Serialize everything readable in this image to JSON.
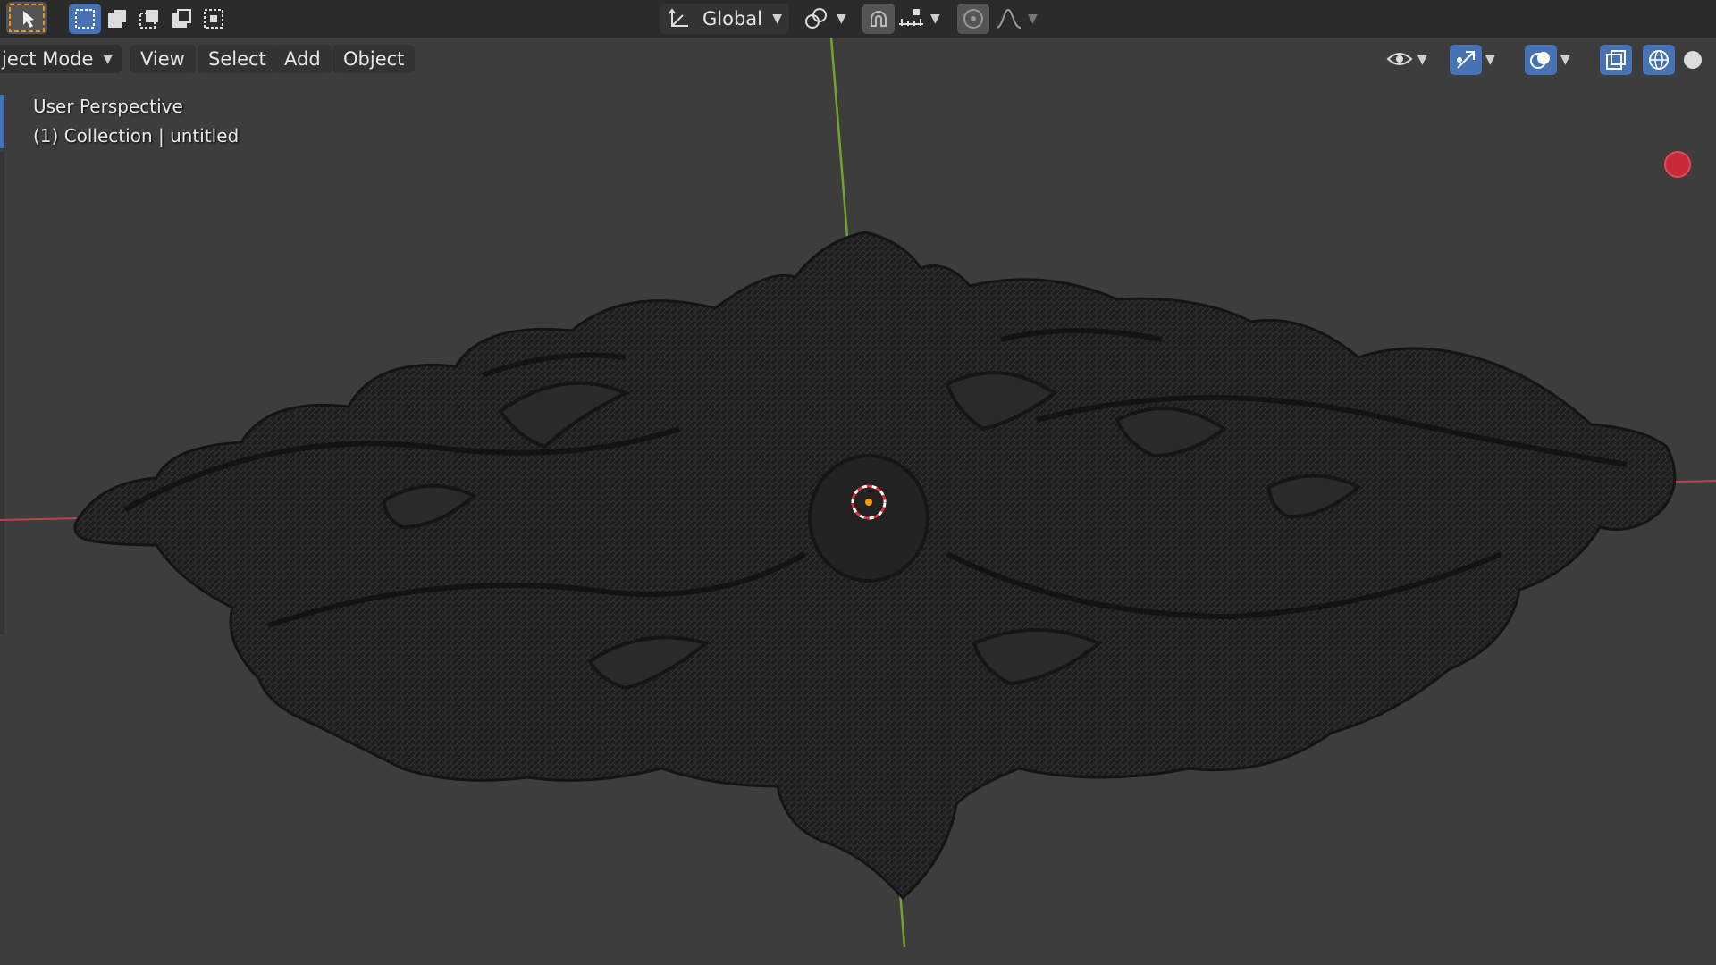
{
  "toolbar": {
    "transform_orientation": "Global",
    "select_tool": "select-tool-icon",
    "select_modes": [
      "select-new-icon",
      "select-extend-icon",
      "select-subtract-icon",
      "select-invert-icon",
      "select-intersect-icon"
    ]
  },
  "header": {
    "mode_label": "ject Mode",
    "menus": [
      "View",
      "Select",
      "Add",
      "Object"
    ]
  },
  "viewport": {
    "view_name": "User Perspective",
    "collection_info": "(1) Collection | untitled"
  },
  "colors": {
    "accent": "#4772b3",
    "x_axis": "#d9444f",
    "y_axis": "#7cb927",
    "tool_highlight": "#e8912d",
    "object": "#1c1c1c"
  }
}
